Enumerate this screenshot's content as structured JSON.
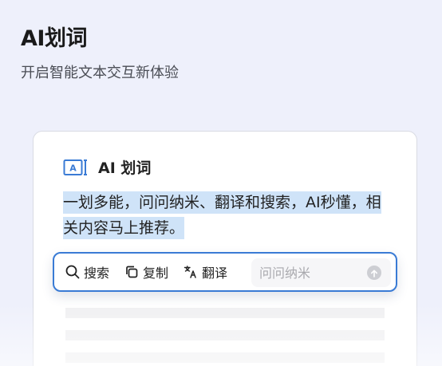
{
  "hero": {
    "title": "AI划词",
    "subtitle": "开启智能文本交互新体验"
  },
  "card": {
    "icon": "ai-text-select-icon",
    "title": "AI 划词",
    "selected_text": "一划多能，问问纳米、翻译和搜索，AI秒懂，相关内容马上推荐。"
  },
  "toolbar": {
    "search_label": "搜索",
    "search_icon": "search-icon",
    "copy_label": "复制",
    "copy_icon": "copy-icon",
    "translate_label": "翻译",
    "translate_icon": "translate-icon",
    "ask_placeholder": "问问纳米",
    "send_icon": "send-arrow-up-icon"
  },
  "colors": {
    "background": "#eef0fb",
    "accent": "#3a7bd5",
    "selection_highlight": "#cfe3f8"
  }
}
